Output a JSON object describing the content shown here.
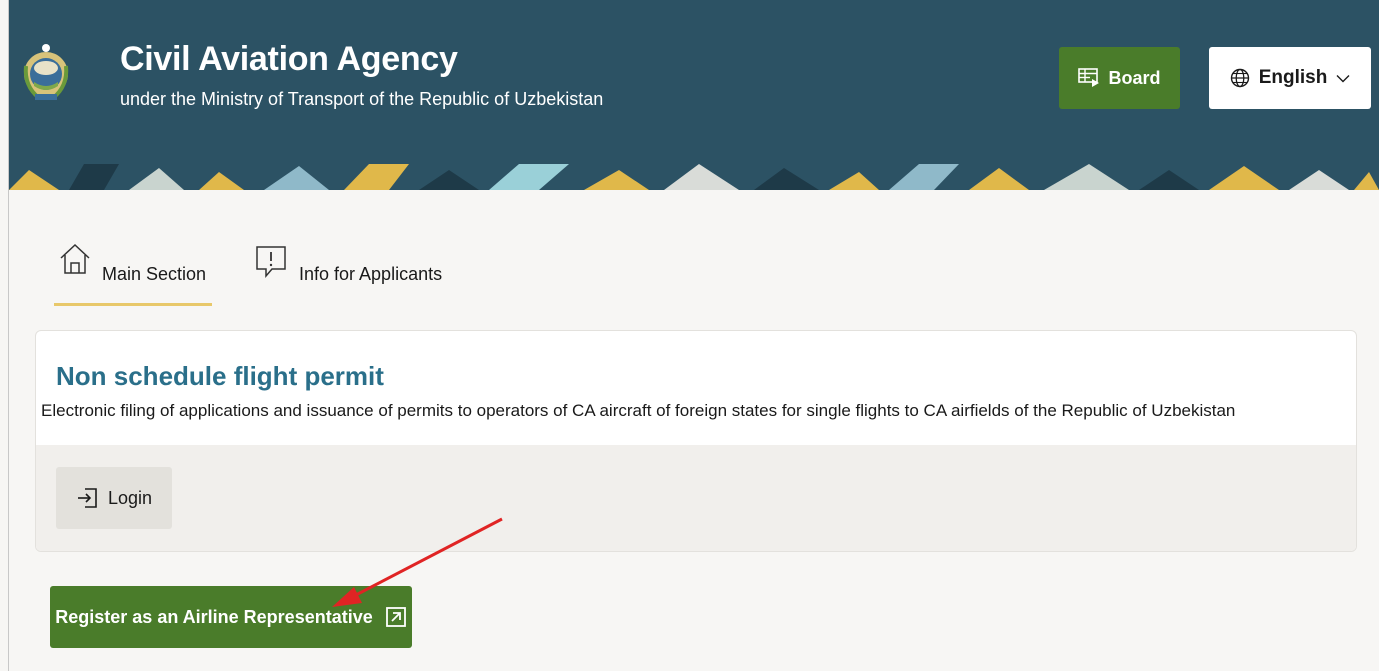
{
  "header": {
    "title": "Civil Aviation Agency",
    "subtitle": "under the Ministry of Transport of the Republic of Uzbekistan",
    "board_label": "Board",
    "language_label": "English",
    "emblem_icon": "state-emblem-icon",
    "colors": {
      "background": "#2c5264",
      "accent_green": "#4a7c2a"
    }
  },
  "tabs": [
    {
      "label": "Main Section",
      "icon": "home-icon",
      "active": true
    },
    {
      "label": "Info for Applicants",
      "icon": "info-message-icon",
      "active": false
    }
  ],
  "card": {
    "title": "Non schedule flight permit",
    "description": "Electronic filing of applications and issuance of permits to operators of CA aircraft of foreign states for single flights to CA airfields of the Republic of Uzbekistan",
    "login_label": "Login"
  },
  "register": {
    "label": "Register as an Airline Representative"
  }
}
